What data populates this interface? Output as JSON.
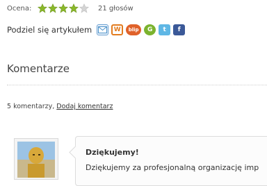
{
  "rating": {
    "label": "Ocena:",
    "value": 4,
    "max": 5,
    "votes_text": "21 głosów",
    "filled_color": "#8ab82a",
    "empty_color": "#d4d4d4"
  },
  "share": {
    "label": "Podziel się artykułem",
    "icons": [
      {
        "name": "email-icon",
        "color": "#4a90c8"
      },
      {
        "name": "wykop-icon",
        "color": "#e27b1e"
      },
      {
        "name": "blip-icon",
        "color": "#e0622a"
      },
      {
        "name": "gg-icon",
        "color": "#7bb32e"
      },
      {
        "name": "twitter-icon",
        "color": "#5fb7e5"
      },
      {
        "name": "facebook-icon",
        "color": "#3b5998"
      }
    ]
  },
  "comments": {
    "title": "Komentarze",
    "count_text": "5 komentarzy,",
    "add_link": "Dodaj komentarz",
    "first": {
      "title": "Dziękujemy!",
      "text": "Dziękujemy za profesjonalną organizację imp"
    }
  }
}
